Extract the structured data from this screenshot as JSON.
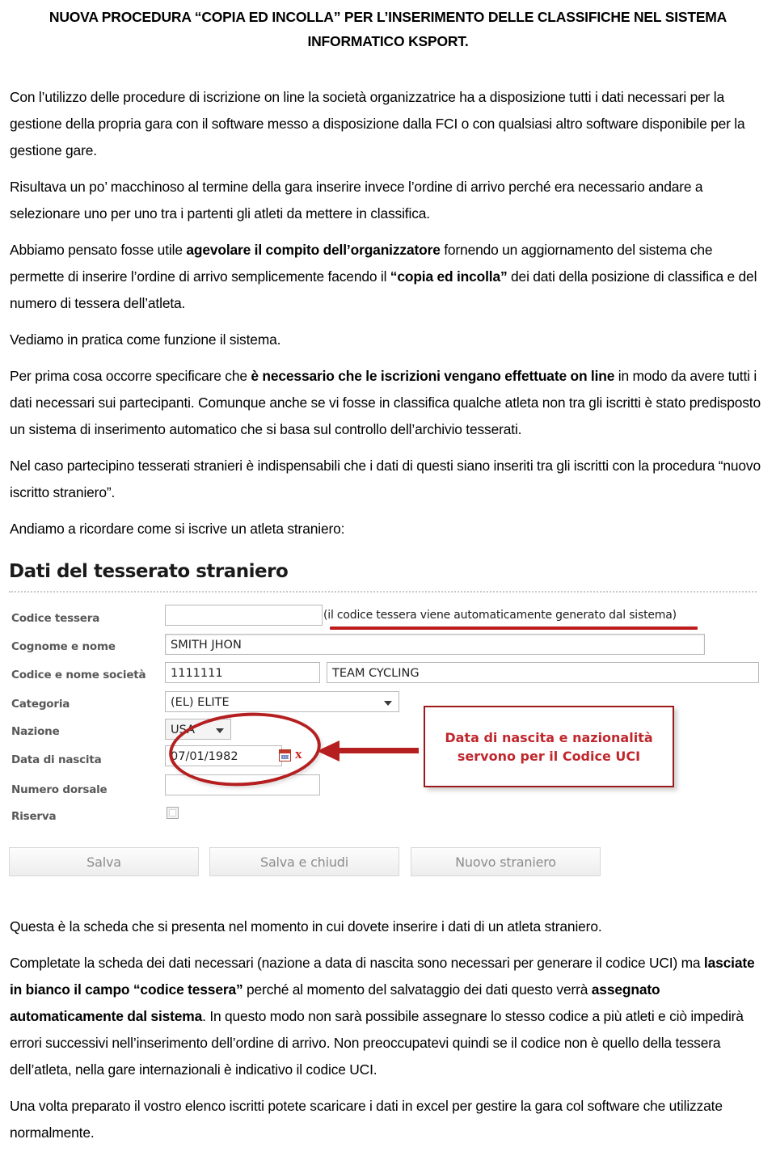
{
  "document": {
    "title": "NUOVA PROCEDURA “COPIA ED INCOLLA” PER L’INSERIMENTO DELLE CLASSIFICHE NEL SISTEMA INFORMATICO KSPORT.",
    "paragraphs": {
      "p1": "Con l’utilizzo delle procedure di iscrizione on line la società organizzatrice ha a disposizione tutti i dati necessari per la gestione della propria gara con il software messo a disposizione dalla FCI o con qualsiasi altro software disponibile per la gestione gare.",
      "p2": "Risultava  un po’ macchinoso al termine della gara inserire invece l’ordine di arrivo perché era necessario andare a selezionare uno per uno tra i partenti gli atleti da mettere in classifica.",
      "p3_a": "Abbiamo pensato fosse utile ",
      "p3_b": "agevolare il compito dell’organizzatore",
      "p3_c": " fornendo un aggiornamento del sistema che permette di inserire l’ordine di arrivo semplicemente facendo il ",
      "p3_d": "“copia ed incolla”",
      "p3_e": " dei dati della posizione di classifica e del numero di tessera dell’atleta.",
      "p4": "Vediamo in pratica come funzione il sistema.",
      "p5_a": "Per prima cosa occorre specificare che ",
      "p5_b": "è necessario che le iscrizioni vengano effettuate on line",
      "p5_c": " in modo da avere tutti i dati necessari sui partecipanti. Comunque anche se vi fosse in classifica qualche atleta non tra gli iscritti è stato predisposto un sistema di inserimento automatico che si basa sul controllo dell’archivio tesserati.",
      "p6": "Nel caso partecipino tesserati stranieri è indispensabili che i dati di questi siano inseriti tra gli iscritti con la procedura “nuovo iscritto straniero”.",
      "p7": "Andiamo a ricordare come si iscrive un atleta straniero:",
      "p8": "Questa è la scheda che si presenta nel momento in cui dovete inserire i dati di un atleta straniero.",
      "p9_a": "Completate la scheda dei dati necessari (nazione a data di nascita sono necessari per generare il codice UCI) ma ",
      "p9_b": "lasciate in bianco il campo “codice tessera”",
      "p9_c": " perché al momento del salvataggio dei dati questo verrà ",
      "p9_d": "assegnato automaticamente dal sistema",
      "p9_e": ". In questo modo non sarà possibile assegnare lo stesso codice a più atleti e ciò impedirà errori successivi nell’inserimento dell’ordine di arrivo. Non preoccupatevi  quindi se il codice non è quello della tessera dell’atleta, nella gare internazionali è indicativo il codice UCI.",
      "p10": "Una volta preparato il vostro elenco iscritti potete scaricare i dati in excel per gestire la gara col  software che utilizzate normalmente."
    }
  },
  "form": {
    "heading": "Dati del tesserato straniero",
    "fields": {
      "codice_tessera": {
        "label": "Codice tessera",
        "value": "",
        "hint": "(il codice tessera viene automaticamente generato dal sistema)"
      },
      "cognome_nome": {
        "label": "Cognome e nome",
        "value": "SMITH JHON"
      },
      "codice_societa": {
        "label": "Codice e nome società",
        "value": "1111111",
        "value2": "TEAM CYCLING"
      },
      "categoria": {
        "label": "Categoria",
        "value": "(EL) ELITE"
      },
      "nazione": {
        "label": "Nazione",
        "value": "USA"
      },
      "data_nascita": {
        "label": "Data di nascita",
        "value": "07/01/1982",
        "clear_mark": "x"
      },
      "numero_dorsale": {
        "label": "Numero dorsale",
        "value": ""
      },
      "riserva": {
        "label": "Riserva",
        "checked": false
      }
    },
    "buttons": {
      "salva": "Salva",
      "salva_chiudi": "Salva e chiudi",
      "nuovo_straniero": "Nuovo straniero"
    },
    "annotation": {
      "line1": "Data di nascita e nazionalità",
      "line2": "servono per il Codice UCI"
    },
    "colors": {
      "annotation_red": "#c0272d",
      "highlight_red": "#b51f1f",
      "label_gray": "#585858"
    }
  }
}
